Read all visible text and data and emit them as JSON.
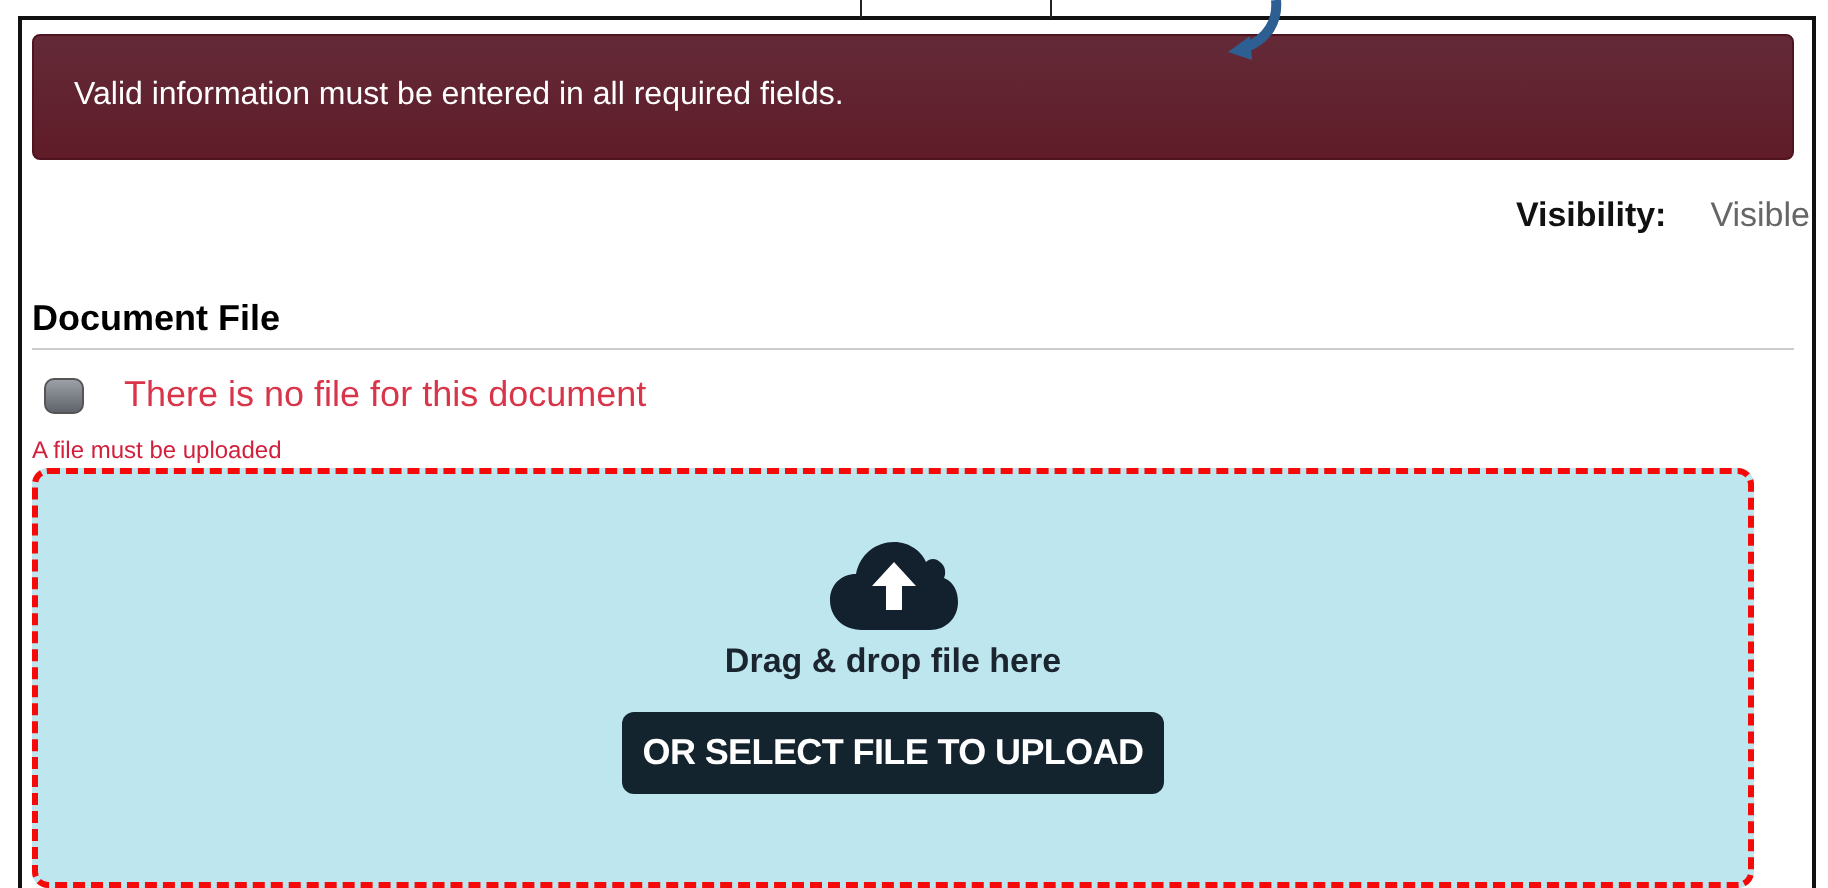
{
  "alert": {
    "message": "Valid information must be entered in all required fields."
  },
  "visibility": {
    "label": "Visibility:",
    "value": "Visible"
  },
  "section": {
    "title": "Document File"
  },
  "no_file": {
    "label": "There is no file for this document",
    "checked": false
  },
  "error": "A file must be uploaded",
  "dropzone": {
    "hint": "Drag & drop file here",
    "button": "OR SELECT FILE TO UPLOAD",
    "invalid": true
  }
}
